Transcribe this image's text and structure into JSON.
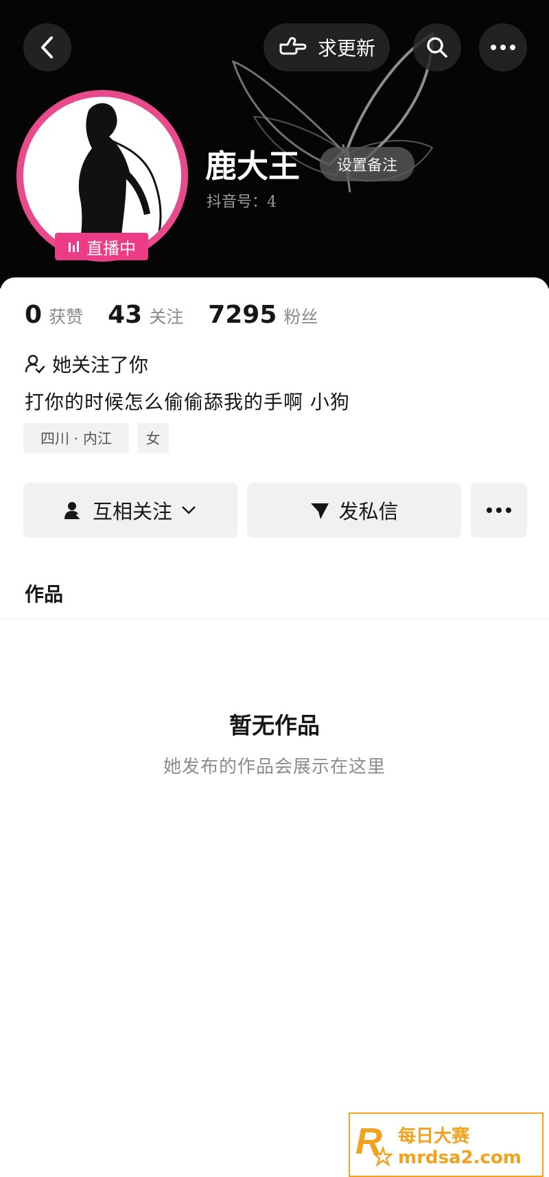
{
  "header": {
    "boost_label": "求更新",
    "live_badge": "直播中",
    "name": "鹿大王",
    "remark_button": "设置备注",
    "douyin_id": "抖音号：4"
  },
  "stats": [
    {
      "num": "0",
      "label": "获赞"
    },
    {
      "num": "43",
      "label": "关注"
    },
    {
      "num": "7295",
      "label": "粉丝"
    }
  ],
  "follow_note": "她关注了你",
  "bio": "打你的时候怎么偷偷舔我的手啊 小狗",
  "tags": {
    "location": "四川 · 内江",
    "gender": "女"
  },
  "actions": {
    "follow": "互相关注",
    "message": "发私信"
  },
  "works_tab": "作品",
  "empty": {
    "title": "暂无作品",
    "subtitle": "她发布的作品会展示在这里"
  },
  "watermark": {
    "cn": "每日大赛",
    "url": "mrdsa2.com"
  },
  "colors": {
    "live": "#ec3c86",
    "watermark": "#f1a21f"
  }
}
